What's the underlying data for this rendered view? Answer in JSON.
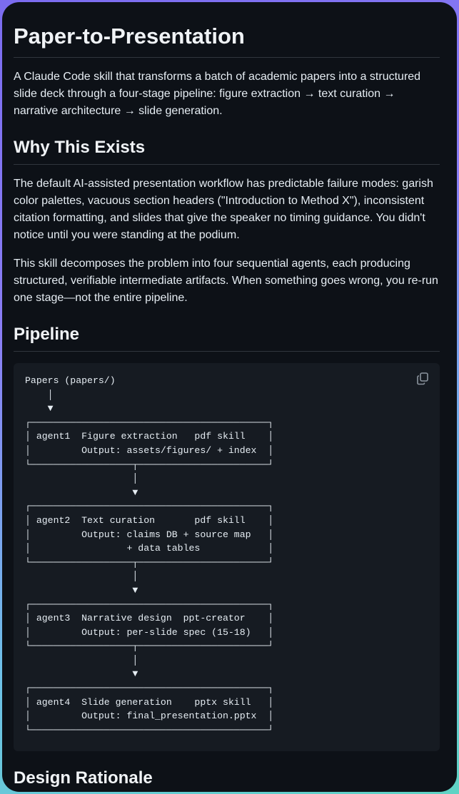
{
  "title": "Paper-to-Presentation",
  "intro": "A Claude Code skill that transforms a batch of academic papers into a structured slide deck through a four-stage pipeline: figure extraction → text curation → narrative architecture → slide generation.",
  "why": {
    "heading": "Why This Exists",
    "p1": "The default AI-assisted presentation workflow has predictable failure modes: garish color palettes, vacuous section headers (\"Introduction to Method X\"), inconsistent citation formatting, and slides that give the speaker no timing guidance. You didn't notice until you were standing at the podium.",
    "p2": "This skill decomposes the problem into four sequential agents, each producing structured, verifiable intermediate artifacts. When something goes wrong, you re-run one stage—not the entire pipeline."
  },
  "pipeline": {
    "heading": "Pipeline",
    "code": "Papers (papers/)\n    │\n    ▼\n┌──────────────────────────────────────────┐\n│ agent1  Figure extraction   pdf skill    │\n│         Output: assets/figures/ + index  │\n└──────────────────┬───────────────────────┘\n                   │\n                   ▼\n┌──────────────────────────────────────────┐\n│ agent2  Text curation       pdf skill    │\n│         Output: claims DB + source map   │\n│                 + data tables            │\n└──────────────────┬───────────────────────┘\n                   │\n                   ▼\n┌──────────────────────────────────────────┐\n│ agent3  Narrative design  ppt-creator    │\n│         Output: per-slide spec (15-18)   │\n└──────────────────┬───────────────────────┘\n                   │\n                   ▼\n┌──────────────────────────────────────────┐\n│ agent4  Slide generation    pptx skill   │\n│         Output: final_presentation.pptx  │\n└──────────────────────────────────────────┘",
    "copy_icon": "copy-icon"
  },
  "design": {
    "heading": "Design Rationale"
  },
  "colors": {
    "background": "#0d1117",
    "code_background": "#161b22",
    "text": "#e6edf3",
    "rule": "#30363d"
  }
}
